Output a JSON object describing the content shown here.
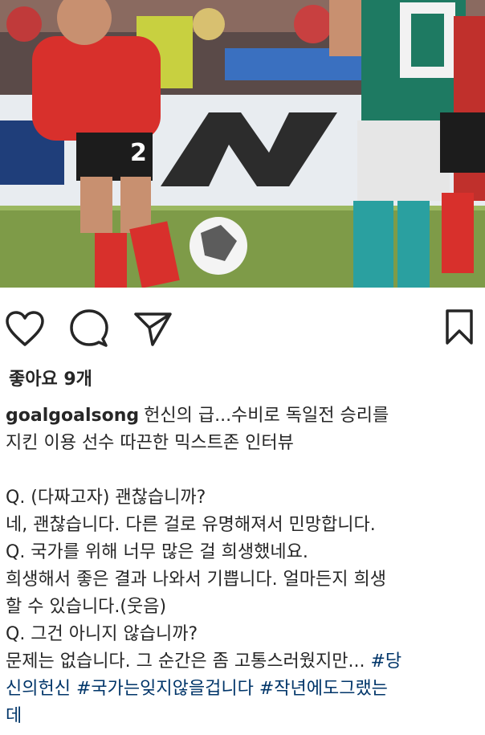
{
  "post": {
    "image_alt_icon": "soccer-match-photo",
    "likes_label": "좋아요 9개",
    "username": "goalgoalsong",
    "caption_line1": "헌신의 급...수비로 독일전 승리를",
    "caption_line2": "지킨 이용 선수 따끈한 믹스트존 인터뷰",
    "qa_lines": [
      "Q. (다짜고자) 괜찮습니까?",
      "네, 괜찮습니다. 다른 걸로 유명해져서 민망합니다.",
      "Q. 국가를 위해 너무 많은 걸 희생했네요.",
      "희생해서 좋은 결과 나와서 기쁩니다. 얼마든지 희생",
      "할 수 있습니다.(웃음)",
      "Q. 그건 아니지 않습니까?"
    ],
    "last_line_text": "문제는 없습니다. 그 순간은 좀 고통스러웠지만... ",
    "hashtag1_part1": "#당",
    "hashtag1_part2": "신의헌신",
    "hashtag2": "#국가는잊지않을겁니다",
    "hashtag3_part1": "#작년에도그랬는",
    "hashtag3_part2": "데"
  },
  "icons": {
    "like": "heart-outline-icon",
    "comment": "speech-bubble-icon",
    "share": "paper-plane-icon",
    "save": "bookmark-icon"
  },
  "colors": {
    "text": "#262626",
    "hashtag": "#003569"
  }
}
